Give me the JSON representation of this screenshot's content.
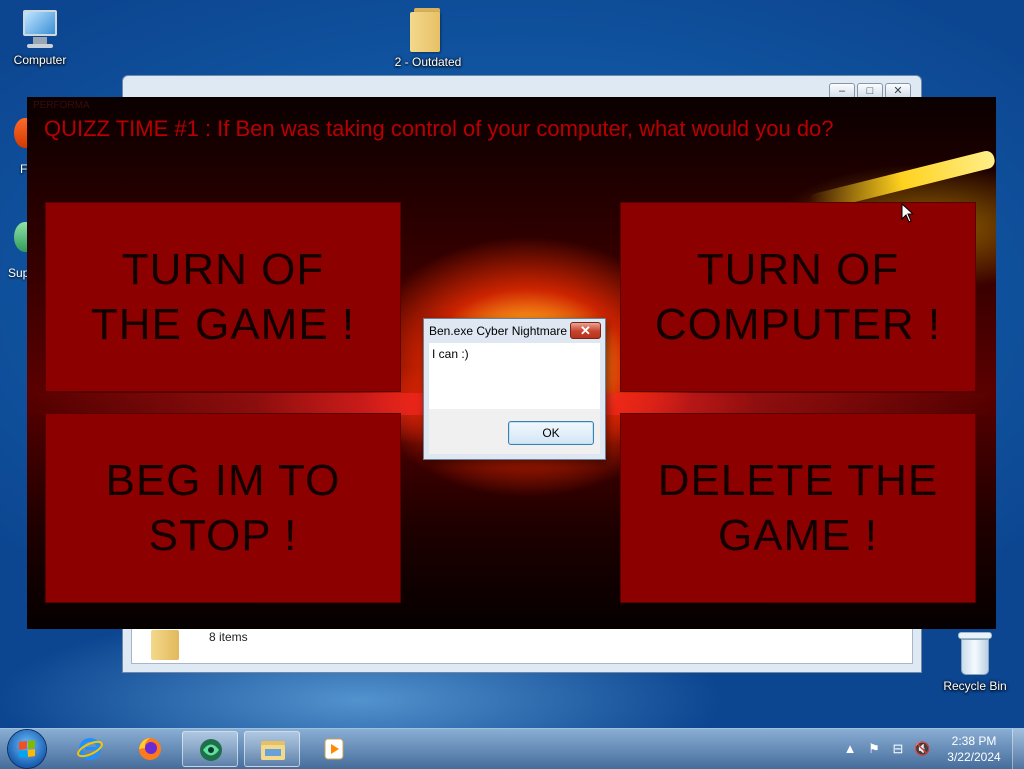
{
  "desktop": {
    "icons": [
      {
        "label": "Computer"
      },
      {
        "label": "2 - Outdated"
      },
      {
        "label": "Recycle Bin"
      }
    ],
    "partial_labels": [
      "F",
      "Sup"
    ]
  },
  "explorer": {
    "status_text": "8 items",
    "caption_buttons": {
      "minimize": "–",
      "maximize": "□",
      "close": "✕"
    }
  },
  "game": {
    "faint_label": "PERFORMA",
    "question": "QUIZZ TIME #1 : If Ben was taking control of your computer, what would you do?",
    "answers": [
      {
        "line1": "TURN OF",
        "line2": "THE GAME !"
      },
      {
        "line1": "TURN OF",
        "line2": "COMPUTER !"
      },
      {
        "line1": "BEG IM TO",
        "line2": "STOP !"
      },
      {
        "line1": "DELETE THE",
        "line2": "GAME !"
      }
    ],
    "colors": {
      "title": "#b80000",
      "answer_bg": "#8c0000",
      "answer_text": "#120000"
    }
  },
  "dialog": {
    "title": "Ben.exe  Cyber Nightmare",
    "message": "I can :)",
    "ok_label": "OK",
    "close_glyph": "✕"
  },
  "taskbar": {
    "buttons": [
      {
        "name": "internet-explorer-icon"
      },
      {
        "name": "firefox-icon"
      },
      {
        "name": "game-app-icon",
        "active": true
      },
      {
        "name": "file-explorer-icon",
        "active": true
      },
      {
        "name": "media-player-icon"
      }
    ],
    "tray": {
      "chevron": "▲",
      "flag": "⚑",
      "network": "⊟",
      "volume": "🔇"
    },
    "clock": {
      "time": "2:38 PM",
      "date": "3/22/2024"
    }
  }
}
